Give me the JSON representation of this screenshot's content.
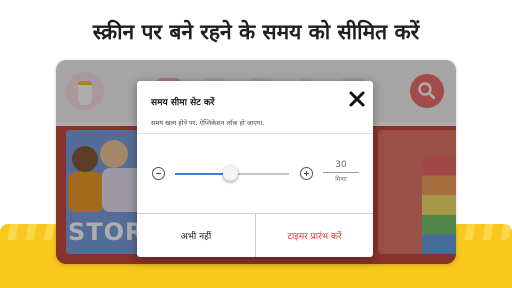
{
  "headline": "स्क्रीन पर बने रहने के समय को सीमित करें",
  "dialog": {
    "title": "समय सीमा सेट करें",
    "subtitle": "समय खत्म होने पर, ऐप्लिकेशन लॉक हो जाएगा.",
    "slider": {
      "value": 30,
      "unit": "मिनट",
      "level_fraction": 0.48
    },
    "cancel_label": "अभी नहीं",
    "confirm_label": "टाइमर प्रारंभ करें"
  },
  "background_thumbnail": {
    "label": "STOR"
  },
  "colors": {
    "accent_red": "#d83a2b",
    "slider_blue": "#3f7ddd",
    "search_button": "#f16e6e",
    "banner_yellow": "#f7c81e"
  },
  "icons": {
    "app_logo": "app-logo-icon",
    "search": "search-icon",
    "close": "close-icon",
    "minus": "minus-circle-icon",
    "plus": "plus-circle-icon"
  }
}
